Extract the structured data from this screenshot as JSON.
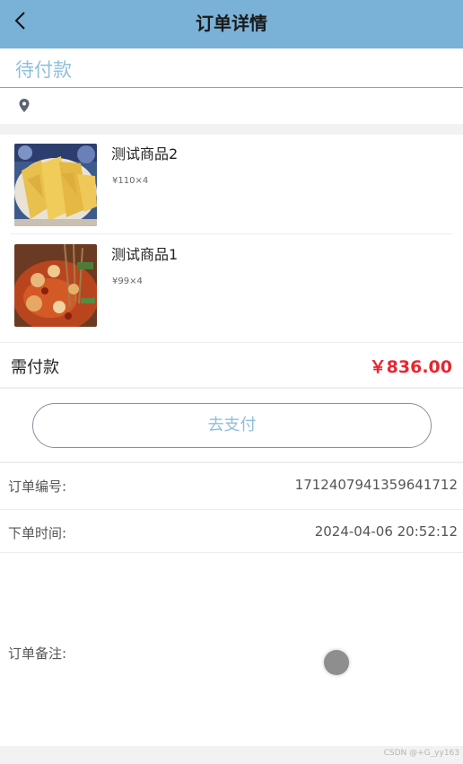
{
  "header": {
    "title": "订单详情"
  },
  "order": {
    "status": "待付款"
  },
  "address": {
    "text": ""
  },
  "goods": [
    {
      "name": "测试商品2",
      "price": "¥110×4",
      "image": "food-photo-chicken"
    },
    {
      "name": "测试商品1",
      "price": "¥99×4",
      "image": "food-photo-skewers"
    }
  ],
  "payment": {
    "label": "需付款",
    "amount": "￥836.00",
    "button_label": "去支付"
  },
  "info": {
    "order_no_label": "订单编号:",
    "order_no": "1712407941359641712",
    "time_label": "下单时间:",
    "time": "2024-04-06 20:52:12",
    "remark_label": "订单备注:"
  },
  "watermark": "CSDN @+G_yy163",
  "colors": {
    "header": "#7ab1d6",
    "status": "#8fbfdc",
    "price": "#e8262f",
    "button_text": "#8fbfdc"
  }
}
